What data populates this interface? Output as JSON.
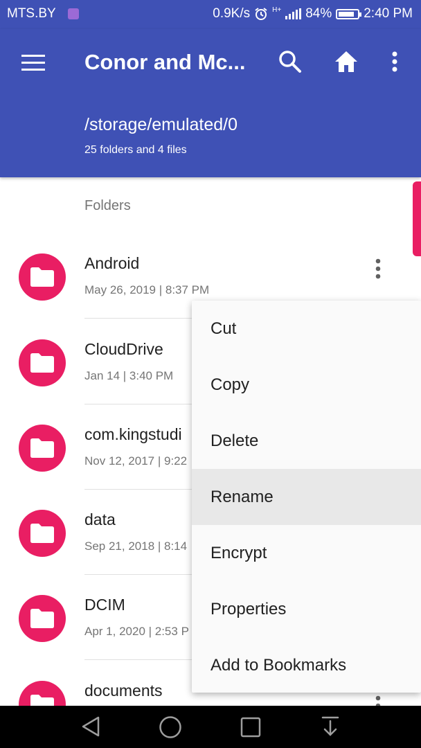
{
  "status_bar": {
    "carrier": "MTS.BY",
    "network_speed": "0.9K/s",
    "network_type": "H+",
    "battery": "84%",
    "battery_level": 0.84,
    "time": "2:40 PM"
  },
  "app_bar": {
    "title": "Conor and Mc...",
    "path": "/storage/emulated/0",
    "subtitle": "25 folders and 4 files",
    "color": "#3f51b5"
  },
  "list": {
    "section_header": "Folders",
    "folders": [
      {
        "name": "Android",
        "date": "May 26, 2019 | 8:37 PM"
      },
      {
        "name": "CloudDrive",
        "date": "Jan 14 | 3:40 PM"
      },
      {
        "name": "com.kingstudi",
        "date": "Nov 12, 2017 | 9:22"
      },
      {
        "name": "data",
        "date": "Sep 21, 2018 | 8:14"
      },
      {
        "name": "DCIM",
        "date": "Apr 1, 2020 | 2:53 P"
      },
      {
        "name": "documents",
        "date": ""
      }
    ],
    "accent": "#e91e63"
  },
  "context_menu": {
    "items": [
      {
        "label": "Cut"
      },
      {
        "label": "Copy"
      },
      {
        "label": "Delete"
      },
      {
        "label": "Rename"
      },
      {
        "label": "Encrypt"
      },
      {
        "label": "Properties"
      },
      {
        "label": "Add to Bookmarks"
      }
    ],
    "selected": "Rename"
  },
  "icons": [
    "menu-icon",
    "search-icon",
    "home-icon",
    "more-vert-icon",
    "folder-icon",
    "back-icon",
    "home-nav-icon",
    "recents-icon",
    "notification-pull-icon",
    "alarm-icon",
    "signal-icon",
    "battery-icon",
    "gallery-notification-icon"
  ]
}
